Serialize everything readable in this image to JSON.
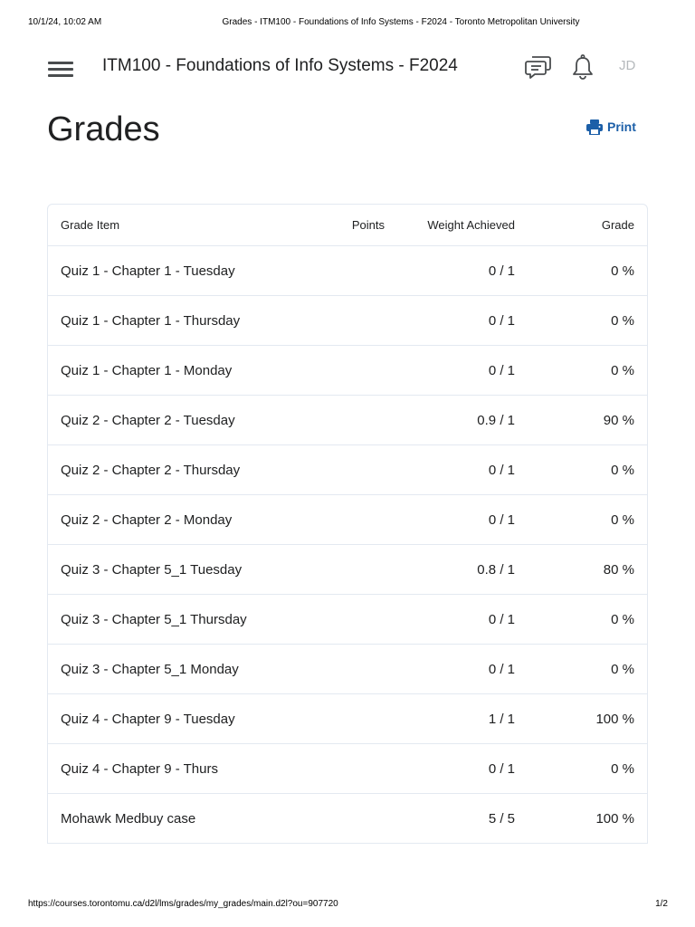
{
  "print_header": {
    "datetime": "10/1/24, 10:02 AM",
    "page_title": "Grades - ITM100 - Foundations of Info Systems - F2024 - Toronto Metropolitan University"
  },
  "navbar": {
    "course_title": "ITM100 - Foundations of Info Systems - F2024",
    "icons": [
      "menu-icon",
      "chat-icon",
      "bell-icon"
    ],
    "user_initials": "JD"
  },
  "page": {
    "title": "Grades",
    "print_label": "Print",
    "accent_color": "#1c5fa8"
  },
  "table": {
    "headers": {
      "item": "Grade Item",
      "points": "Points",
      "weight": "Weight Achieved",
      "grade": "Grade"
    },
    "rows": [
      {
        "item": "Quiz 1 - Chapter 1 - Tuesday",
        "points": "",
        "weight": "0 / 1",
        "grade": "0 %"
      },
      {
        "item": "Quiz 1 - Chapter 1 - Thursday",
        "points": "",
        "weight": "0 / 1",
        "grade": "0 %"
      },
      {
        "item": "Quiz 1 - Chapter 1 - Monday",
        "points": "",
        "weight": "0 / 1",
        "grade": "0 %"
      },
      {
        "item": "Quiz 2 - Chapter 2 - Tuesday",
        "points": "",
        "weight": "0.9 / 1",
        "grade": "90 %"
      },
      {
        "item": "Quiz 2 - Chapter 2 - Thursday",
        "points": "",
        "weight": "0 / 1",
        "grade": "0 %"
      },
      {
        "item": "Quiz 2 - Chapter 2 - Monday",
        "points": "",
        "weight": "0 / 1",
        "grade": "0 %"
      },
      {
        "item": "Quiz 3 - Chapter 5_1 Tuesday",
        "points": "",
        "weight": "0.8 / 1",
        "grade": "80 %"
      },
      {
        "item": "Quiz 3 - Chapter 5_1 Thursday",
        "points": "",
        "weight": "0 / 1",
        "grade": "0 %"
      },
      {
        "item": "Quiz 3 - Chapter 5_1 Monday",
        "points": "",
        "weight": "0 / 1",
        "grade": "0 %"
      },
      {
        "item": "Quiz 4 - Chapter 9 - Tuesday",
        "points": "",
        "weight": "1 / 1",
        "grade": "100 %"
      },
      {
        "item": "Quiz 4 - Chapter 9 - Thurs",
        "points": "",
        "weight": "0 / 1",
        "grade": "0 %"
      },
      {
        "item": "Mohawk Medbuy case",
        "points": "",
        "weight": "5 / 5",
        "grade": "100 %"
      }
    ]
  },
  "print_footer": {
    "url": "https://courses.torontomu.ca/d2l/lms/grades/my_grades/main.d2l?ou=907720",
    "page_number": "1/2"
  }
}
